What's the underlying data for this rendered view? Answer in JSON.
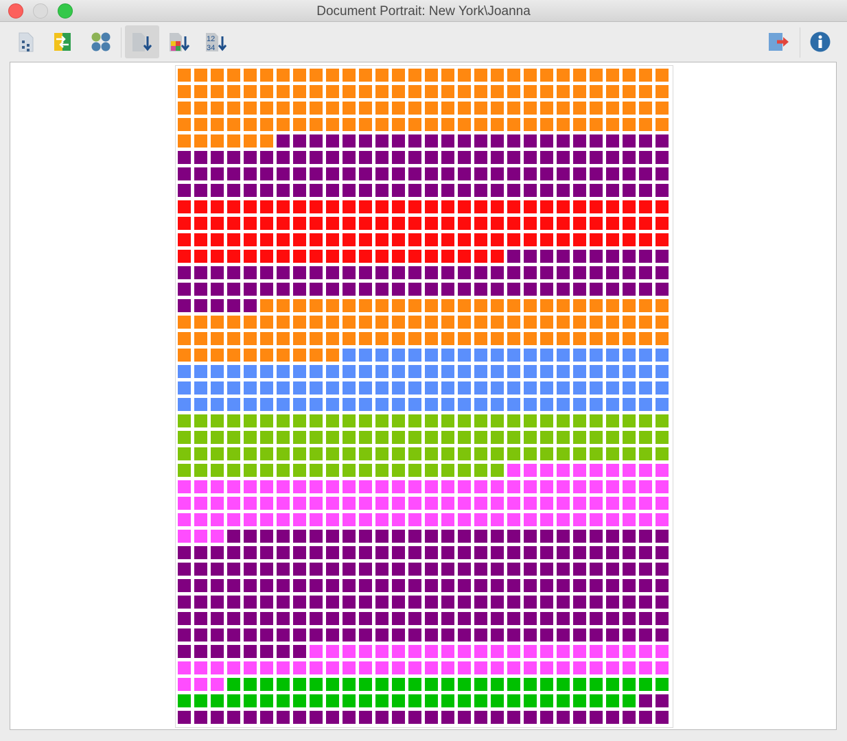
{
  "window": {
    "title": "Document Portrait: New York\\Joanna"
  },
  "toolbar": {
    "left_icons": [
      "document-dots-icon",
      "transfer-arrows-icon",
      "circles-icon",
      "sort-down-icon",
      "color-sort-down-icon",
      "numeric-sort-icon"
    ],
    "right_icons": [
      "export-icon",
      "info-icon"
    ]
  },
  "portrait": {
    "columns": 30,
    "rows": 40,
    "palette": {
      "O": "#ff8810",
      "P": "#800080",
      "R": "#ff0c0c",
      "B": "#5b8ffc",
      "G": "#7ec40a",
      "M": "#ff4dff",
      "D": "#00c000"
    },
    "color_runs": [
      [
        "O",
        126
      ],
      [
        "P",
        114
      ],
      [
        "R",
        110
      ],
      [
        "P",
        75
      ],
      [
        "O",
        95
      ],
      [
        "B",
        110
      ],
      [
        "G",
        110
      ],
      [
        "M",
        103
      ],
      [
        "P",
        215
      ],
      [
        "M",
        55
      ],
      [
        "D",
        55
      ],
      [
        "P",
        32
      ]
    ]
  }
}
